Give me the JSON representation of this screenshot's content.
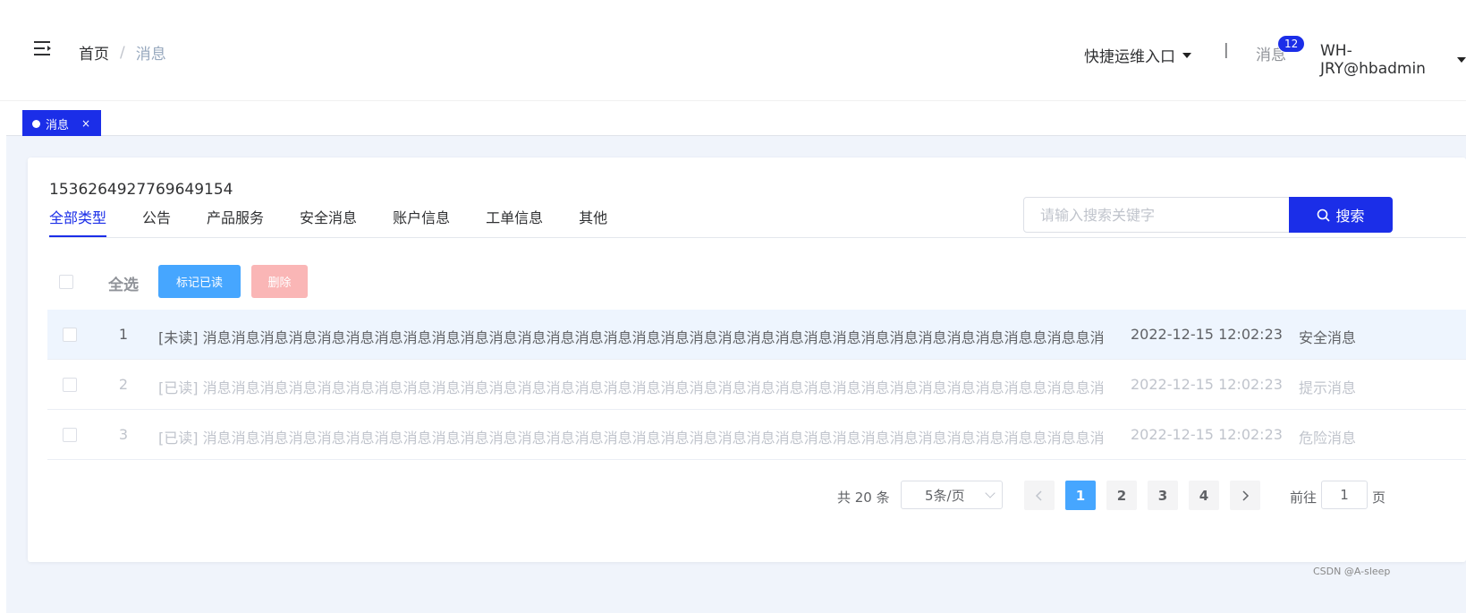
{
  "header": {
    "menu_icon": "menu-fold-icon",
    "breadcrumb": {
      "home": "首页",
      "separator": "/",
      "current": "消息"
    },
    "quick_entry": "快捷运维入口",
    "divider": "|",
    "messages_label": "消息",
    "messages_badge": "12",
    "username": "WH-JRY@hbadmin"
  },
  "tags": [
    {
      "label": "消息",
      "close": "×",
      "active": true
    }
  ],
  "card": {
    "id_text": "1536264927769649154",
    "tabs": [
      "全部类型",
      "公告",
      "产品服务",
      "安全消息",
      "账户信息",
      "工单信息",
      "其他"
    ],
    "active_tab": 0,
    "search": {
      "placeholder": "请输入搜索关键字",
      "value": "",
      "button_label": "搜索"
    },
    "toolbar": {
      "select_all": "全选",
      "mark_read": "标记已读",
      "delete": "删除"
    },
    "rows": [
      {
        "index": "1",
        "content": "[未读] 消息消息消息消息消息消息消息消息消息消息消息消息消息消息消息消息消息消息消息消息消息消息消息消息消息消息消息消息消息息消息息消息息消息息消",
        "time": "2022-12-15 12:02:23",
        "type": "安全消息",
        "read": false
      },
      {
        "index": "2",
        "content": "[已读] 消息消息消息消息消息消息消息消息消息消息消息消息消息消息消息消息消息消息消息消息消息消息消息消息消息消息消息消息消息息消息息消息息消息息消",
        "time": "2022-12-15 12:02:23",
        "type": "提示消息",
        "read": true
      },
      {
        "index": "3",
        "content": "[已读] 消息消息消息消息消息消息消息消息消息消息消息消息消息消息消息消息消息消息消息消息消息消息消息消息消息消息消息消息消息息消息息消息息消息息消",
        "time": "2022-12-15 12:02:23",
        "type": "危险消息",
        "read": true
      }
    ],
    "pagination": {
      "total_text": "共 20 条",
      "page_size": "5条/页",
      "pages": [
        "1",
        "2",
        "3",
        "4"
      ],
      "current_page": "1",
      "prev_icon": "chevron-left-icon",
      "next_icon": "chevron-right-icon",
      "goto_label": "前往",
      "goto_value": "1",
      "goto_suffix": "页"
    }
  },
  "watermark": "CSDN @A-sleep",
  "colors": {
    "primary": "#1b2ee8",
    "light_blue": "#46a6ff",
    "danger_light": "#fab6b6"
  }
}
